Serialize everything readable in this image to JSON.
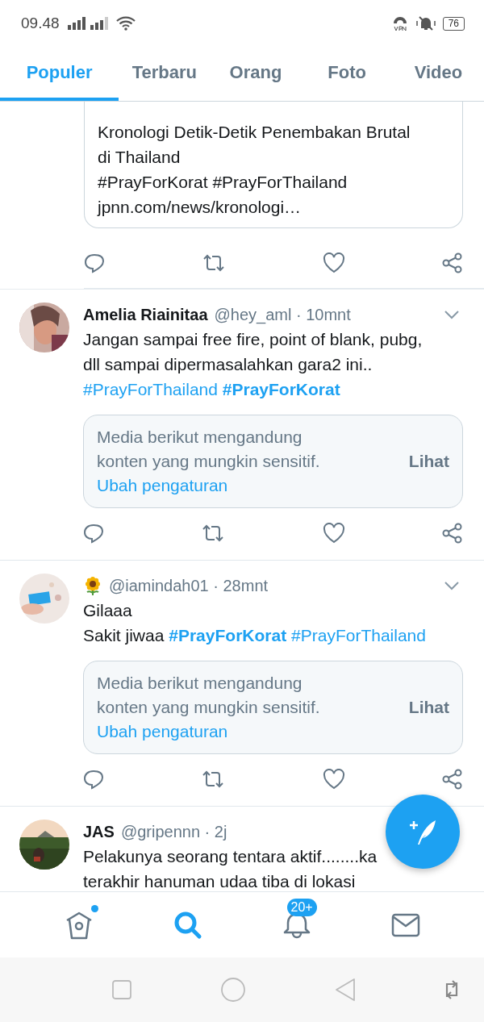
{
  "status_bar": {
    "time": "09.48",
    "battery": "76"
  },
  "tabs": [
    {
      "label": "Populer",
      "selected": true
    },
    {
      "label": "Terbaru",
      "selected": false
    },
    {
      "label": "Orang",
      "selected": false
    },
    {
      "label": "Foto",
      "selected": false
    },
    {
      "label": "Video",
      "selected": false
    }
  ],
  "tweets": [
    {
      "kind": "quote_tail",
      "lines": [
        [
          {
            "text": "Kronologi Detik-Detik Penembakan Brutal",
            "kind": "text"
          }
        ],
        [
          {
            "text": "di Thailand",
            "kind": "text"
          }
        ],
        [
          {
            "text": "#PrayForKorat #PrayForThailand",
            "kind": "text"
          }
        ],
        [
          {
            "text": "jpnn.com/news/kronologi…",
            "kind": "text"
          }
        ]
      ]
    },
    {
      "kind": "tweet",
      "name": "Amelia Riainitaa",
      "meta": "@hey_aml · 10mnt",
      "lines": [
        [
          {
            "text": "Jangan sampai free fire, point of blank, pubg,",
            "kind": "text"
          }
        ],
        [
          {
            "text": "dll sampai dipermasalahkan gara2 ini..",
            "kind": "text"
          }
        ],
        [
          {
            "text": "#PrayForThailand",
            "kind": "hashtag"
          },
          {
            "text": "#PrayForKorat",
            "kind": "hashtag_bold"
          }
        ]
      ],
      "sensitive": {
        "text": "Media berikut mengandung konten yang mungkin sensitif.",
        "link": "Ubah pengaturan",
        "action": "Lihat"
      }
    },
    {
      "kind": "tweet",
      "meta": "@iamindah01 · 28mnt",
      "lines": [
        [
          {
            "text": "Gilaaa",
            "kind": "text"
          }
        ],
        [
          {
            "text": "Sakit jiwaa",
            "kind": "text"
          },
          {
            "text": "#PrayForKorat",
            "kind": "hashtag_bold"
          },
          {
            "text": "#PrayForThailand",
            "kind": "hashtag"
          }
        ]
      ],
      "sensitive": {
        "text": "Media berikut mengandung konten yang mungkin sensitif.",
        "link": "Ubah pengaturan",
        "action": "Lihat"
      }
    },
    {
      "kind": "tweet_cut",
      "name": "JAS",
      "meta": "@gripennn · 2j",
      "lines": [
        [
          {
            "text": "Pelakunya seorang tentara aktif........ka",
            "kind": "text"
          }
        ],
        [
          {
            "text": "terakhir hanuman udaa tiba di lokasi",
            "kind": "text"
          }
        ]
      ]
    }
  ],
  "bottom_nav": [
    {
      "kind": "home",
      "selected": false,
      "dot": true
    },
    {
      "kind": "search",
      "selected": true
    },
    {
      "kind": "notifications",
      "selected": false,
      "badge": "20+"
    },
    {
      "kind": "messages",
      "selected": false
    }
  ]
}
